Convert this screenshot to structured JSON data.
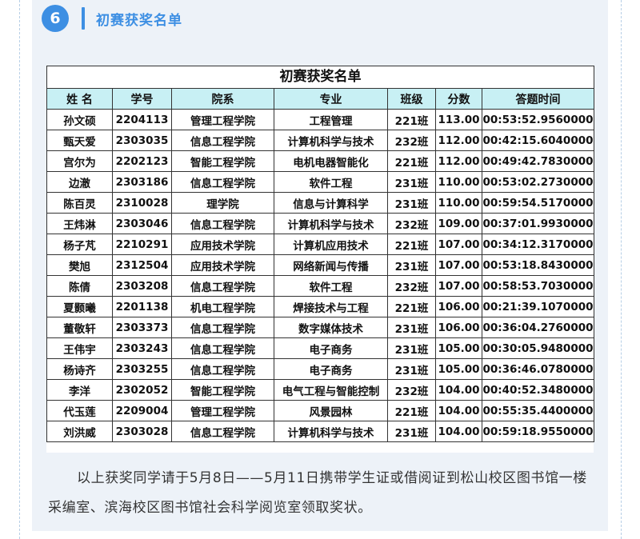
{
  "section": {
    "number": "6",
    "title": "初赛获奖名单"
  },
  "table": {
    "title": "初赛获奖名单",
    "headers": [
      "姓 名",
      "学号",
      "院系",
      "专业",
      "班级",
      "分数",
      "答题时间"
    ],
    "rows": [
      [
        "孙文硕",
        "2204113",
        "管理工程学院",
        "工程管理",
        "221班",
        "113.00",
        "00:53:52.9560000"
      ],
      [
        "甄天爱",
        "2303035",
        "信息工程学院",
        "计算机科学与技术",
        "232班",
        "112.00",
        "00:42:15.6040000"
      ],
      [
        "宫尔为",
        "2202123",
        "智能工程学院",
        "电机电器智能化",
        "221班",
        "112.00",
        "00:49:42.7830000"
      ],
      [
        "边澈",
        "2303186",
        "信息工程学院",
        "软件工程",
        "231班",
        "110.00",
        "00:53:02.2730000"
      ],
      [
        "陈百灵",
        "2310028",
        "理学院",
        "信息与计算科学",
        "231班",
        "110.00",
        "00:59:54.5170000"
      ],
      [
        "王炜淋",
        "2303046",
        "信息工程学院",
        "计算机科学与技术",
        "232班",
        "109.00",
        "00:37:01.9930000"
      ],
      [
        "杨子芃",
        "2210291",
        "应用技术学院",
        "计算机应用技术",
        "221班",
        "107.00",
        "00:34:12.3170000"
      ],
      [
        "樊旭",
        "2312504",
        "应用技术学院",
        "网络新闻与传播",
        "231班",
        "107.00",
        "00:53:18.8430000"
      ],
      [
        "陈倩",
        "2303208",
        "信息工程学院",
        "软件工程",
        "232班",
        "107.00",
        "00:58:53.7030000"
      ],
      [
        "夏颢曦",
        "2201138",
        "机电工程学院",
        "焊接技术与工程",
        "221班",
        "106.00",
        "00:21:39.1070000"
      ],
      [
        "董敬轩",
        "2303373",
        "信息工程学院",
        "数字媒体技术",
        "231班",
        "106.00",
        "00:36:04.2760000"
      ],
      [
        "王伟宇",
        "2303243",
        "信息工程学院",
        "电子商务",
        "231班",
        "105.00",
        "00:30:05.9480000"
      ],
      [
        "杨诗齐",
        "2303255",
        "信息工程学院",
        "电子商务",
        "231班",
        "105.00",
        "00:36:46.0780000"
      ],
      [
        "李洋",
        "2302052",
        "智能工程学院",
        "电气工程与智能控制",
        "232班",
        "104.00",
        "00:40:52.3480000"
      ],
      [
        "代玉莲",
        "2209004",
        "管理工程学院",
        "风景园林",
        "221班",
        "104.00",
        "00:55:35.4400000"
      ],
      [
        "刘洪威",
        "2303028",
        "信息工程学院",
        "计算机科学与技术",
        "231班",
        "104.00",
        "00:59:18.9550000"
      ]
    ]
  },
  "notice": "以上获奖同学请于5月8日——5月11日携带学生证或借阅证到松山校区图书馆一楼采编室、滨海校区图书馆社会科学阅览室领取奖状。",
  "colors": {
    "accent": "#3d8fe3",
    "card_bg": "#edf2f8",
    "header_row_bg": "#c8f0f4"
  }
}
